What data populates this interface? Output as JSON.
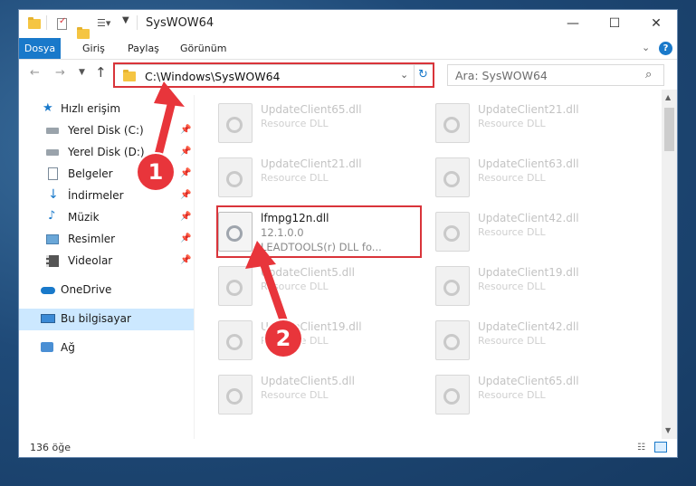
{
  "window": {
    "title": "SysWOW64",
    "controls": {
      "minimize": "—",
      "maximize": "☐",
      "close": "✕"
    }
  },
  "ribbon": {
    "tabs": [
      {
        "label": "Dosya",
        "active": true
      },
      {
        "label": "Giriş"
      },
      {
        "label": "Paylaş"
      },
      {
        "label": "Görünüm"
      }
    ],
    "expand_icon": "chevron-down-icon",
    "help_icon": "help-icon"
  },
  "navbar": {
    "address": "C:\\Windows\\SysWOW64",
    "search_placeholder": "Ara: SysWOW64"
  },
  "sidebar": {
    "items": [
      {
        "label": "Hızlı erişim",
        "icon": "star-icon"
      },
      {
        "label": "Yerel Disk (C:)",
        "icon": "drive-icon",
        "pinned": true
      },
      {
        "label": "Yerel Disk (D:)",
        "icon": "drive-icon",
        "pinned": true
      },
      {
        "label": "Belgeler",
        "icon": "documents-icon",
        "pinned": true
      },
      {
        "label": "İndirmeler",
        "icon": "download-icon",
        "pinned": true
      },
      {
        "label": "Müzik",
        "icon": "music-icon",
        "pinned": true
      },
      {
        "label": "Resimler",
        "icon": "pictures-icon",
        "pinned": true
      },
      {
        "label": "Videolar",
        "icon": "videos-icon",
        "pinned": true
      },
      {
        "label": "OneDrive",
        "icon": "cloud-icon"
      },
      {
        "label": "Bu bilgisayar",
        "icon": "computer-icon",
        "selected": true
      },
      {
        "label": "Ağ",
        "icon": "network-icon"
      }
    ]
  },
  "files": [
    {
      "name": "UpdateClient65.dll",
      "desc": "Resource DLL"
    },
    {
      "name": "UpdateClient21.dll",
      "desc": "Resource DLL"
    },
    {
      "name": "UpdateClient21.dll",
      "desc": "Resource DLL"
    },
    {
      "name": "UpdateClient63.dll",
      "desc": "Resource DLL"
    },
    {
      "name": "lfmpg12n.dll",
      "version": "12.1.0.0",
      "desc": "LEADTOOLS(r) DLL fo...",
      "highlighted": true
    },
    {
      "name": "UpdateClient42.dll",
      "desc": "Resource DLL"
    },
    {
      "name": "UpdateClient5.dll",
      "desc": "Resource DLL"
    },
    {
      "name": "UpdateClient19.dll",
      "desc": "Resource DLL"
    },
    {
      "name": "UpdateClient19.dll",
      "desc": "Resource DLL"
    },
    {
      "name": "UpdateClient42.dll",
      "desc": "Resource DLL"
    },
    {
      "name": "UpdateClient5.dll",
      "desc": "Resource DLL"
    },
    {
      "name": "UpdateClient65.dll",
      "desc": "Resource DLL"
    }
  ],
  "status": {
    "count": "136 öğe"
  },
  "callouts": {
    "step1": "1",
    "step2": "2"
  },
  "colors": {
    "accent": "#1979ca",
    "highlight_red": "#d9343a",
    "selected_bg": "#cce8ff"
  }
}
